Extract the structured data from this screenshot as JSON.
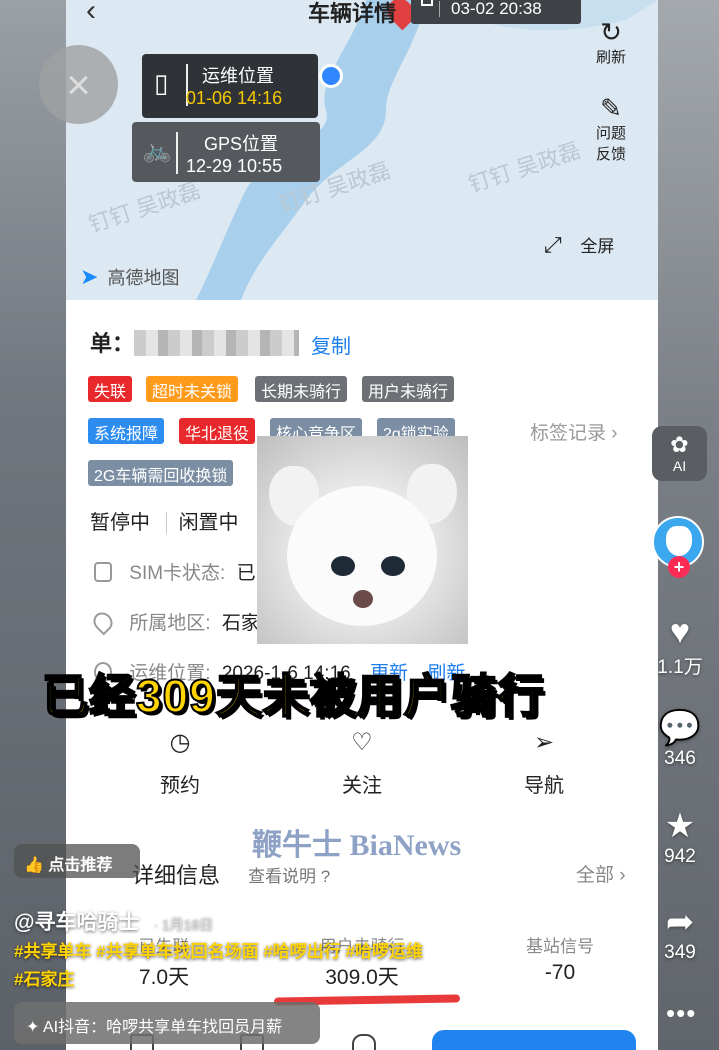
{
  "header": {
    "title": "车辆详情",
    "time_chip": "03-02 20:38",
    "refresh_label": "刷新",
    "feedback_label": "问题反馈",
    "fullscreen_label": "全屏"
  },
  "map": {
    "ops_location_label": "运维位置",
    "ops_location_time": "01-06 14:16",
    "gps_location_label": "GPS位置",
    "gps_location_time": "12-29 10:55",
    "provider": "高德地图",
    "watermark_text": "钉钉 吴政磊"
  },
  "order": {
    "label": "单：",
    "copy_label": "复制"
  },
  "tags": [
    {
      "text": "失联",
      "style": "red"
    },
    {
      "text": "超时未关锁",
      "style": "orange"
    },
    {
      "text": "长期未骑行",
      "style": "gray"
    },
    {
      "text": "用户未骑行",
      "style": "gray"
    },
    {
      "text": "系统报障",
      "style": "blue"
    },
    {
      "text": "华北退役",
      "style": "red"
    },
    {
      "text": "核心竞争区",
      "style": "graybl"
    },
    {
      "text": "2g锁实验",
      "style": "graybl"
    },
    {
      "text": "2G车辆需回收换锁",
      "style": "graybl"
    }
  ],
  "tag_record_label": "标签记录 ›",
  "status": [
    "暂停中",
    "闲置中"
  ],
  "info": {
    "sim_label": "SIM卡状态:",
    "sim_value": "已",
    "region_label": "所属地区:",
    "region_value": "石家",
    "ops_pos_label": "运维位置:",
    "ops_pos_value": "2026-1-6 14:16",
    "update_link": "更新",
    "refresh_link": "刷新"
  },
  "caption": "已经309天未被用户骑行",
  "actions": [
    {
      "label": "预约",
      "icon": "clock-icon"
    },
    {
      "label": "关注",
      "icon": "heart-outline-icon"
    },
    {
      "label": "导航",
      "icon": "navigation-icon"
    }
  ],
  "watermark_news": "鞭牛士 BiaNews",
  "details": {
    "title": "详细信息",
    "help": "查看说明 ?",
    "all": "全部 ›",
    "stats": [
      {
        "label": "已失联",
        "value": "7.0天"
      },
      {
        "label": "用户未骑行",
        "value": "309.0天"
      },
      {
        "label": "基站信号",
        "value": "-70"
      }
    ]
  },
  "overlay": {
    "close_glyph": "×",
    "like_pill": "点击推荐",
    "author": "@寻车哈骑士",
    "date": "· 1月18日",
    "hashtags": "#共享单车 #共享单车找回名场面 #哈啰出行 #哈啰运维 #石家庄",
    "ai_search": "AI抖音：哈啰共享单车找回员月薪",
    "ai_button_label": "AI"
  },
  "rail": {
    "likes": "1.1万",
    "comments": "346",
    "favorites": "942",
    "shares": "349",
    "more": "•••"
  },
  "colors": {
    "accent_blue": "#1d7ef0",
    "caption_yellow": "#ffd400",
    "tag_red": "#e8282a",
    "tag_orange": "#ff9a1a",
    "douyin_red": "#fe2c55"
  }
}
